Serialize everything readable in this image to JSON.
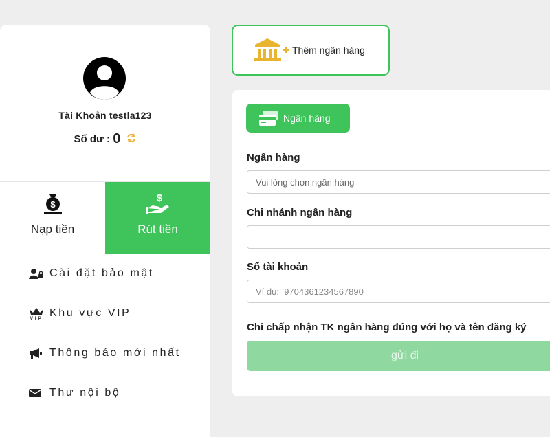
{
  "profile": {
    "account_label": "Tài Khoản testla123",
    "balance_label": "Số dư : ",
    "balance_value": "0"
  },
  "actions": {
    "deposit_label": "Nạp tiền",
    "withdraw_label": "Rút tiền"
  },
  "menu": {
    "items": [
      {
        "label": "Cài đặt bảo mật",
        "icon": "user-lock-icon"
      },
      {
        "label": "Khu vực VIP",
        "icon": "vip-crown-icon"
      },
      {
        "label": "Thông báo mới nhất",
        "icon": "megaphone-icon"
      },
      {
        "label": "Thư nội bộ",
        "icon": "envelope-icon"
      }
    ]
  },
  "add_bank": {
    "label": "Thêm ngân hàng"
  },
  "form": {
    "tab_label": "Ngân hàng",
    "bank_label": "Ngân hàng",
    "bank_placeholder": "Vui lòng chọn ngân hàng",
    "branch_label": "Chi nhánh ngân hàng",
    "branch_value": "",
    "account_label": "Số tài khoản",
    "account_placeholder": "Ví dụ:  9704361234567890",
    "notice": "Chỉ chấp nhận TK ngân hàng đúng với họ và tên đăng ký",
    "submit_label": "gửi đi"
  },
  "colors": {
    "accent_green": "#3fc45c",
    "submit_disabled": "#8fd89f",
    "bank_icon_gold": "#e9b531"
  }
}
